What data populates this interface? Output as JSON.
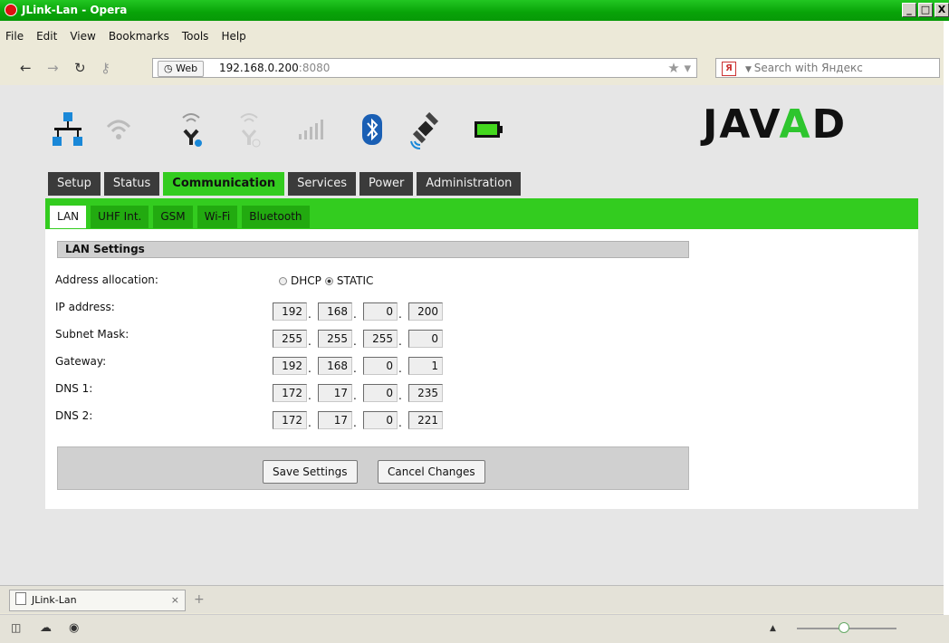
{
  "window": {
    "title": "JLink-Lan - Opera",
    "buttons": [
      "_",
      "□",
      "X"
    ]
  },
  "menu": [
    "File",
    "Edit",
    "View",
    "Bookmarks",
    "Tools",
    "Help"
  ],
  "nav": {
    "back": "←",
    "forward": "→",
    "reload": "↻",
    "key": "⚷"
  },
  "address": {
    "web_button": "Web",
    "url_host": "192.168.0.200",
    "url_port": ":8080"
  },
  "search": {
    "engine_icon": "Я",
    "placeholder": "Search with Яндекс"
  },
  "header_icons": [
    "lan-icon",
    "wifi-icon",
    "wifi-client-icon",
    "wifi-ap-icon",
    "signal-icon",
    "bluetooth-icon",
    "satellite-icon",
    "battery-icon"
  ],
  "brand": {
    "left": "JAV",
    "mid": "A",
    "right": "D"
  },
  "main_tabs": [
    "Setup",
    "Status",
    "Communication",
    "Services",
    "Power",
    "Administration"
  ],
  "sub_tabs": [
    "LAN",
    "UHF Int.",
    "GSM",
    "Wi-Fi",
    "Bluetooth"
  ],
  "section_title": "LAN Settings",
  "address_allocation": {
    "label": "Address allocation:",
    "opt1": "DHCP",
    "opt2": "STATIC",
    "selected": "STATIC"
  },
  "fields": [
    {
      "label": "IP address:",
      "octets": [
        "192",
        "168",
        "0",
        "200"
      ]
    },
    {
      "label": "Subnet Mask:",
      "octets": [
        "255",
        "255",
        "255",
        "0"
      ]
    },
    {
      "label": "Gateway:",
      "octets": [
        "192",
        "168",
        "0",
        "1"
      ]
    },
    {
      "label": "DNS 1:",
      "octets": [
        "172",
        "17",
        "0",
        "235"
      ]
    },
    {
      "label": "DNS 2:",
      "octets": [
        "172",
        "17",
        "0",
        "221"
      ]
    }
  ],
  "buttons": {
    "save": "Save Settings",
    "cancel": "Cancel Changes"
  },
  "page_tab": {
    "title": "JLink-Lan",
    "close": "×",
    "new_tab": "+"
  },
  "colors": {
    "accent_green": "#33cc1f",
    "tab_dark": "#3b3b3b",
    "titlebar_green": "#08a308"
  }
}
